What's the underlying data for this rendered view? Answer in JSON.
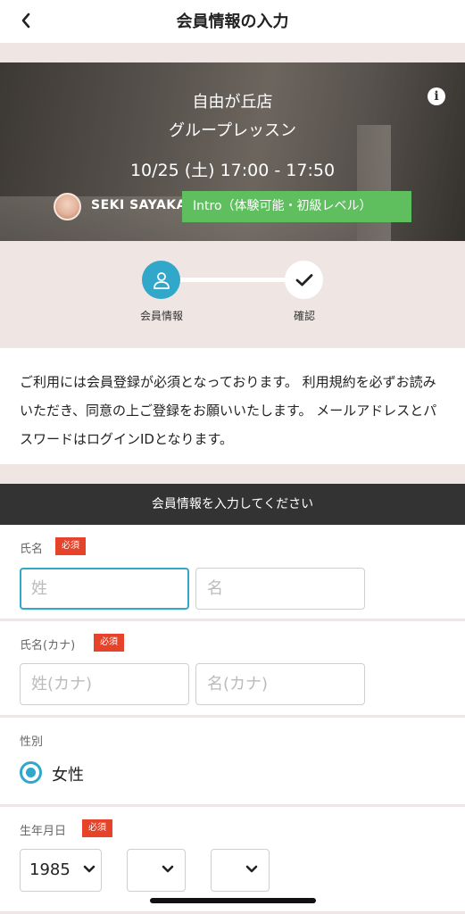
{
  "header": {
    "title": "会員情報の入力",
    "back_icon": "chevron-left-icon"
  },
  "banner": {
    "studio": "自由が丘店",
    "lesson_type": "グループレッスン",
    "datetime": "10/25 (土) 17:00 - 17:50",
    "instructor_name": "SEKI SAYAKA",
    "level": "Intro（体験可能・初級レベル）",
    "info_icon": "info-icon"
  },
  "steps": [
    {
      "label": "会員情報",
      "icon": "user-icon",
      "active": true
    },
    {
      "label": "確認",
      "icon": "check-icon",
      "active": false
    }
  ],
  "notice": "ご利用には会員登録が必須となっております。 利用規約を必ずお読みいただき、同意の上ご登録をお願いいたします。 メールアドレスとパスワードはログインIDとなります。",
  "form": {
    "header": "会員情報を入力してください",
    "required_label": "必須",
    "name": {
      "label": "氏名",
      "last_placeholder": "姓",
      "first_placeholder": "名"
    },
    "kana": {
      "label": "氏名(カナ)",
      "last_placeholder": "姓(カナ)",
      "first_placeholder": "名(カナ)"
    },
    "gender": {
      "label": "性別",
      "option": "女性"
    },
    "birth": {
      "label": "生年月日",
      "year": "1985",
      "month": "",
      "day": ""
    }
  },
  "colors": {
    "accent": "#31a7c9",
    "required": "#e5432a",
    "level_badge": "#5fbf5f",
    "section_bg": "#efe6e4",
    "form_header_bg": "#333333"
  }
}
